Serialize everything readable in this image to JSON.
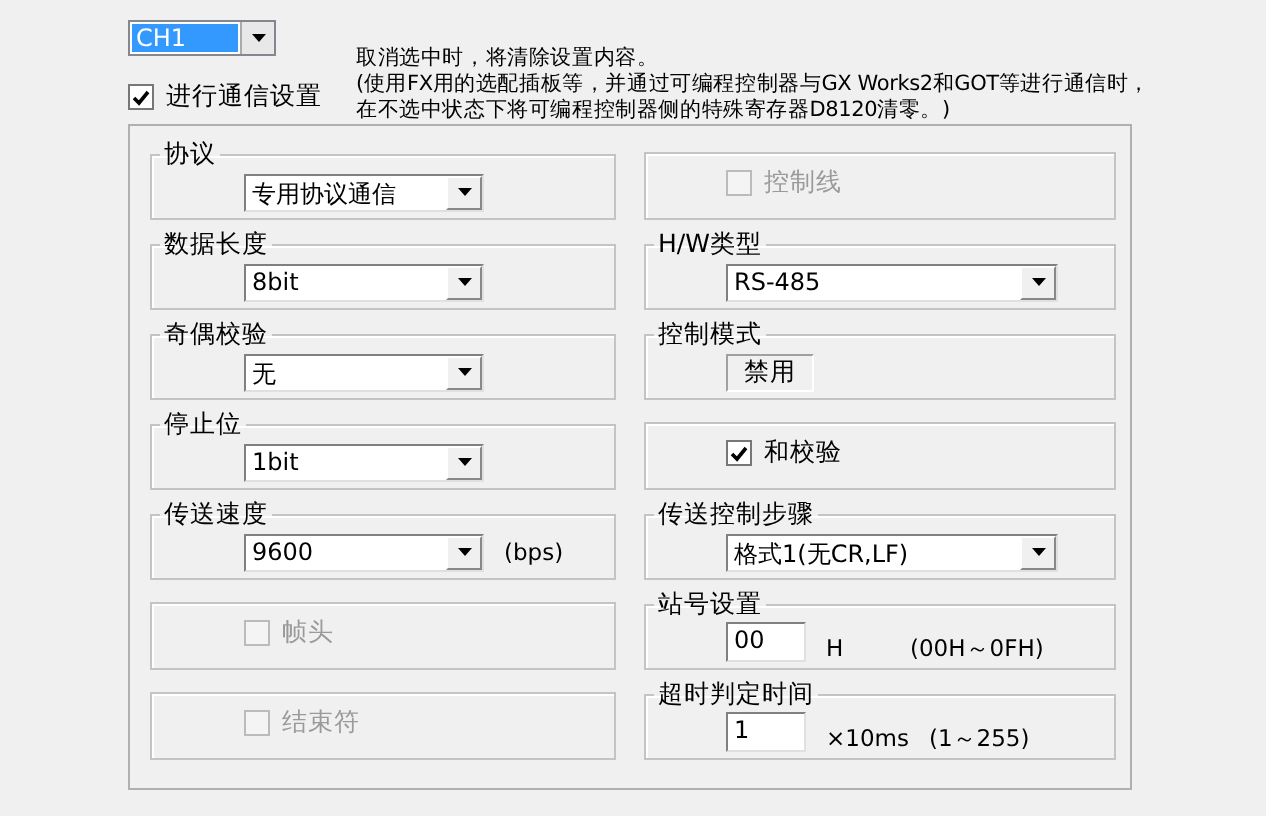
{
  "channel": {
    "value": "CH1",
    "selected": true
  },
  "enable": {
    "label": "进行通信设置",
    "checked": true
  },
  "notes": [
    "取消选中时，将清除设置内容。",
    "(使用FX用的选配插板等，并通过可编程控制器与GX Works2和GOT等进行通信时，在不选中状态下将可编程控制器侧的特殊寄存器D8120清零。)"
  ],
  "left_groups": [
    {
      "kind": "select",
      "legend": "协议",
      "value": "专用协议通信"
    },
    {
      "kind": "select",
      "legend": "数据长度",
      "value": "8bit"
    },
    {
      "kind": "select",
      "legend": "奇偶校验",
      "value": "无"
    },
    {
      "kind": "select",
      "legend": "停止位",
      "value": "1bit"
    },
    {
      "kind": "select",
      "legend": "传送速度",
      "value": "9600",
      "unit": "(bps)"
    },
    {
      "kind": "checkbox",
      "label": "帧头",
      "checked": false,
      "disabled": true
    },
    {
      "kind": "checkbox",
      "label": "结束符",
      "checked": false,
      "disabled": true
    }
  ],
  "right_groups": [
    {
      "kind": "checkbox",
      "label": "控制线",
      "checked": false,
      "disabled": true
    },
    {
      "kind": "select",
      "legend": "H/W类型",
      "value": "RS-485",
      "wide": true
    },
    {
      "kind": "static",
      "legend": "控制模式",
      "value": "禁用"
    },
    {
      "kind": "checkbox",
      "label": "和校验",
      "checked": true,
      "disabled": false
    },
    {
      "kind": "select",
      "legend": "传送控制步骤",
      "value": "格式1(无CR,LF)",
      "wide": true
    },
    {
      "kind": "input",
      "legend": "站号设置",
      "value": "00",
      "unit": "H",
      "range": "(00H～0FH)"
    },
    {
      "kind": "input",
      "legend": "超时判定时间",
      "value": "1",
      "unit": "×10ms",
      "range": "(1～255)"
    }
  ]
}
